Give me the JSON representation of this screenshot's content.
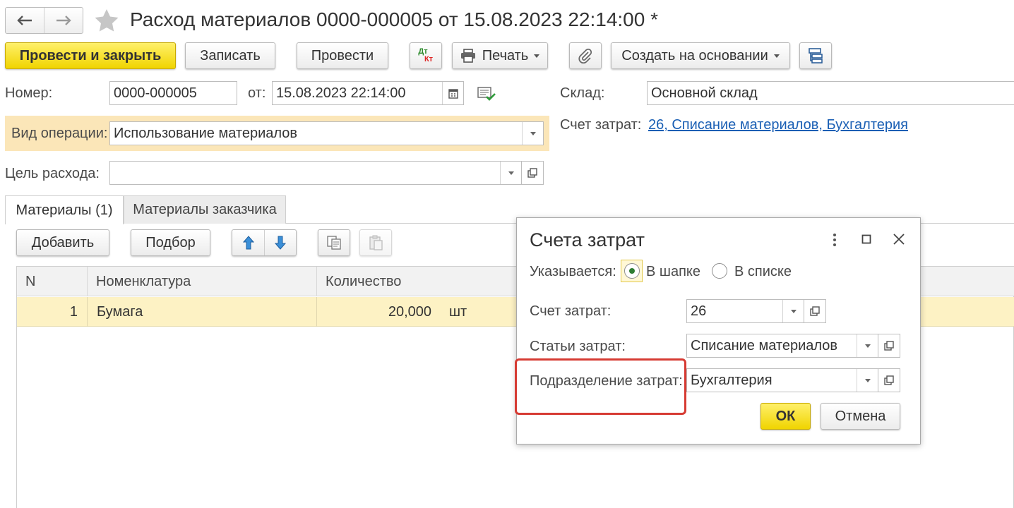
{
  "nav": {
    "back_icon": "arrow-left-icon",
    "forward_icon": "arrow-right-icon",
    "favorite_icon": "star-icon"
  },
  "window": {
    "title": "Расход материалов 0000-000005 от 15.08.2023 22:14:00 *"
  },
  "toolbar": {
    "post_close_label": "Провести и закрыть",
    "save_label": "Записать",
    "post_label": "Провести",
    "dt_label": "Дт",
    "kt_label": "Кт",
    "print_label": "Печать",
    "create_based_label": "Создать на основании"
  },
  "header": {
    "number_label": "Номер:",
    "number_value": "0000-000005",
    "date_label": "от:",
    "date_value": "15.08.2023 22:14:00",
    "warehouse_label": "Склад:",
    "warehouse_value": "Основной склад",
    "operation_label": "Вид операции:",
    "operation_value": "Использование материалов",
    "cost_account_label": "Счет затрат:",
    "cost_account_link": "26, Списание материалов, Бухгалтерия",
    "purpose_label": "Цель расхода:",
    "purpose_value": ""
  },
  "tabs": [
    {
      "label": "Материалы (1)",
      "active": true
    },
    {
      "label": "Материалы заказчика",
      "active": false
    }
  ],
  "table_toolbar": {
    "add_label": "Добавить",
    "pick_label": "Подбор"
  },
  "table": {
    "columns": [
      "N",
      "Номенклатура",
      "Количество"
    ],
    "rows": [
      {
        "n": "1",
        "item": "Бумага",
        "qty": "20,000",
        "unit": "шт"
      }
    ]
  },
  "dialog": {
    "title": "Счета затрат",
    "specified_label": "Указывается:",
    "radio_header_label": "В шапке",
    "radio_list_label": "В списке",
    "selected_option": "В шапке",
    "account_label": "Счет затрат:",
    "account_value": "26",
    "items_label": "Статьи затрат:",
    "items_value": "Списание материалов",
    "division_label": "Подразделение затрат:",
    "division_value": "Бухгалтерия",
    "ok_label": "ОК",
    "cancel_label": "Отмена"
  },
  "colors": {
    "accent_yellow": "#f5dc1c",
    "highlight_row": "#fdf2c4",
    "operation_band": "#fbe6b8",
    "link_blue": "#1a5fb4",
    "annotation_red": "#d63b33"
  }
}
